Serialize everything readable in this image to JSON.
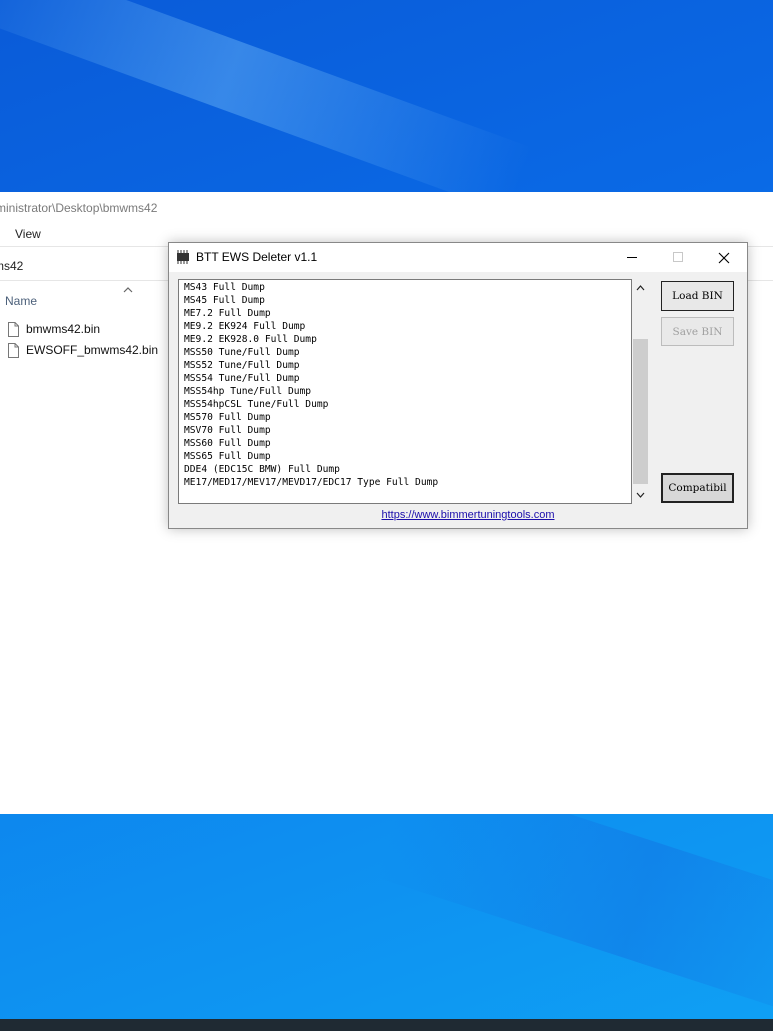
{
  "explorer": {
    "path_title": "ministrator\\Desktop\\bmwms42",
    "ribbon_view": "View",
    "address": "ms42",
    "column_name": "Name",
    "files": [
      {
        "name": "bmwms42.bin"
      },
      {
        "name": "EWSOFF_bmwms42.bin"
      }
    ]
  },
  "dialog": {
    "title": "BTT EWS Deleter v1.1",
    "list_items": [
      "MS43 Full Dump",
      "MS45 Full Dump",
      "ME7.2 Full Dump",
      "ME9.2 EK924 Full Dump",
      "ME9.2 EK928.0 Full Dump",
      "MSS50 Tune/Full Dump",
      "MSS52 Tune/Full Dump",
      "MSS54 Tune/Full Dump",
      "MSS54hp Tune/Full Dump",
      "MSS54hpCSL Tune/Full Dump",
      "MS570 Full Dump",
      "MSV70 Full Dump",
      "MSS60 Full Dump",
      "MSS65 Full Dump",
      "DDE4 (EDC15C BMW) Full Dump",
      "ME17/MED17/MEV17/MEVD17/EDC17 Type Full Dump"
    ],
    "load_button": "Load BIN",
    "save_button": "Save BIN",
    "compat_button": "Compatibil",
    "link": "https://www.bimmertuningtools.com"
  },
  "colors": {
    "desktop_blue": "#0a6ae6",
    "link": "#1a0dab",
    "disabled_text": "#a0a0a0"
  }
}
